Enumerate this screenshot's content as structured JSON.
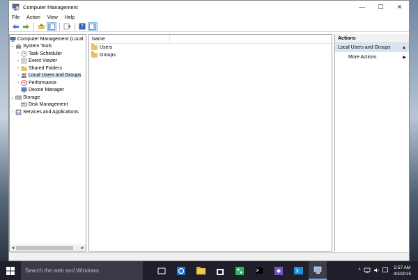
{
  "window": {
    "title": "Computer Management",
    "controls": {
      "minimize": "—",
      "maximize": "☐",
      "close": "✕"
    }
  },
  "menu": [
    "File",
    "Action",
    "View",
    "Help"
  ],
  "tree": {
    "root": "Computer Management (Local",
    "items": [
      {
        "label": "System Tools",
        "level": 1,
        "expander": "⌄",
        "icon": "tools-icon"
      },
      {
        "label": "Task Scheduler",
        "level": 2,
        "expander": "›",
        "icon": "clock-icon"
      },
      {
        "label": "Event Viewer",
        "level": 2,
        "expander": "›",
        "icon": "event-viewer-icon"
      },
      {
        "label": "Shared Folders",
        "level": 2,
        "expander": "›",
        "icon": "shared-folder-icon"
      },
      {
        "label": "Local Users and Groups",
        "level": 2,
        "expander": "›",
        "icon": "users-icon",
        "selected": true
      },
      {
        "label": "Performance",
        "level": 2,
        "expander": "›",
        "icon": "performance-icon"
      },
      {
        "label": "Device Manager",
        "level": 2,
        "expander": "",
        "icon": "device-manager-icon"
      },
      {
        "label": "Storage",
        "level": 1,
        "expander": "⌄",
        "icon": "storage-icon"
      },
      {
        "label": "Disk Management",
        "level": 2,
        "expander": "",
        "icon": "disk-icon"
      },
      {
        "label": "Services and Applications",
        "level": 1,
        "expander": "›",
        "icon": "services-icon"
      }
    ]
  },
  "list": {
    "column": "Name",
    "items": [
      "Users",
      "Groups"
    ]
  },
  "actions": {
    "header": "Actions",
    "section": "Local Users and Groups",
    "section_arrow": "▲",
    "more": "More Actions",
    "more_arrow": "▶"
  },
  "taskbar": {
    "search_placeholder": "Search the web and Windows",
    "time": "5:57 AM",
    "date": "4/3/2015",
    "tray_up": "^"
  }
}
